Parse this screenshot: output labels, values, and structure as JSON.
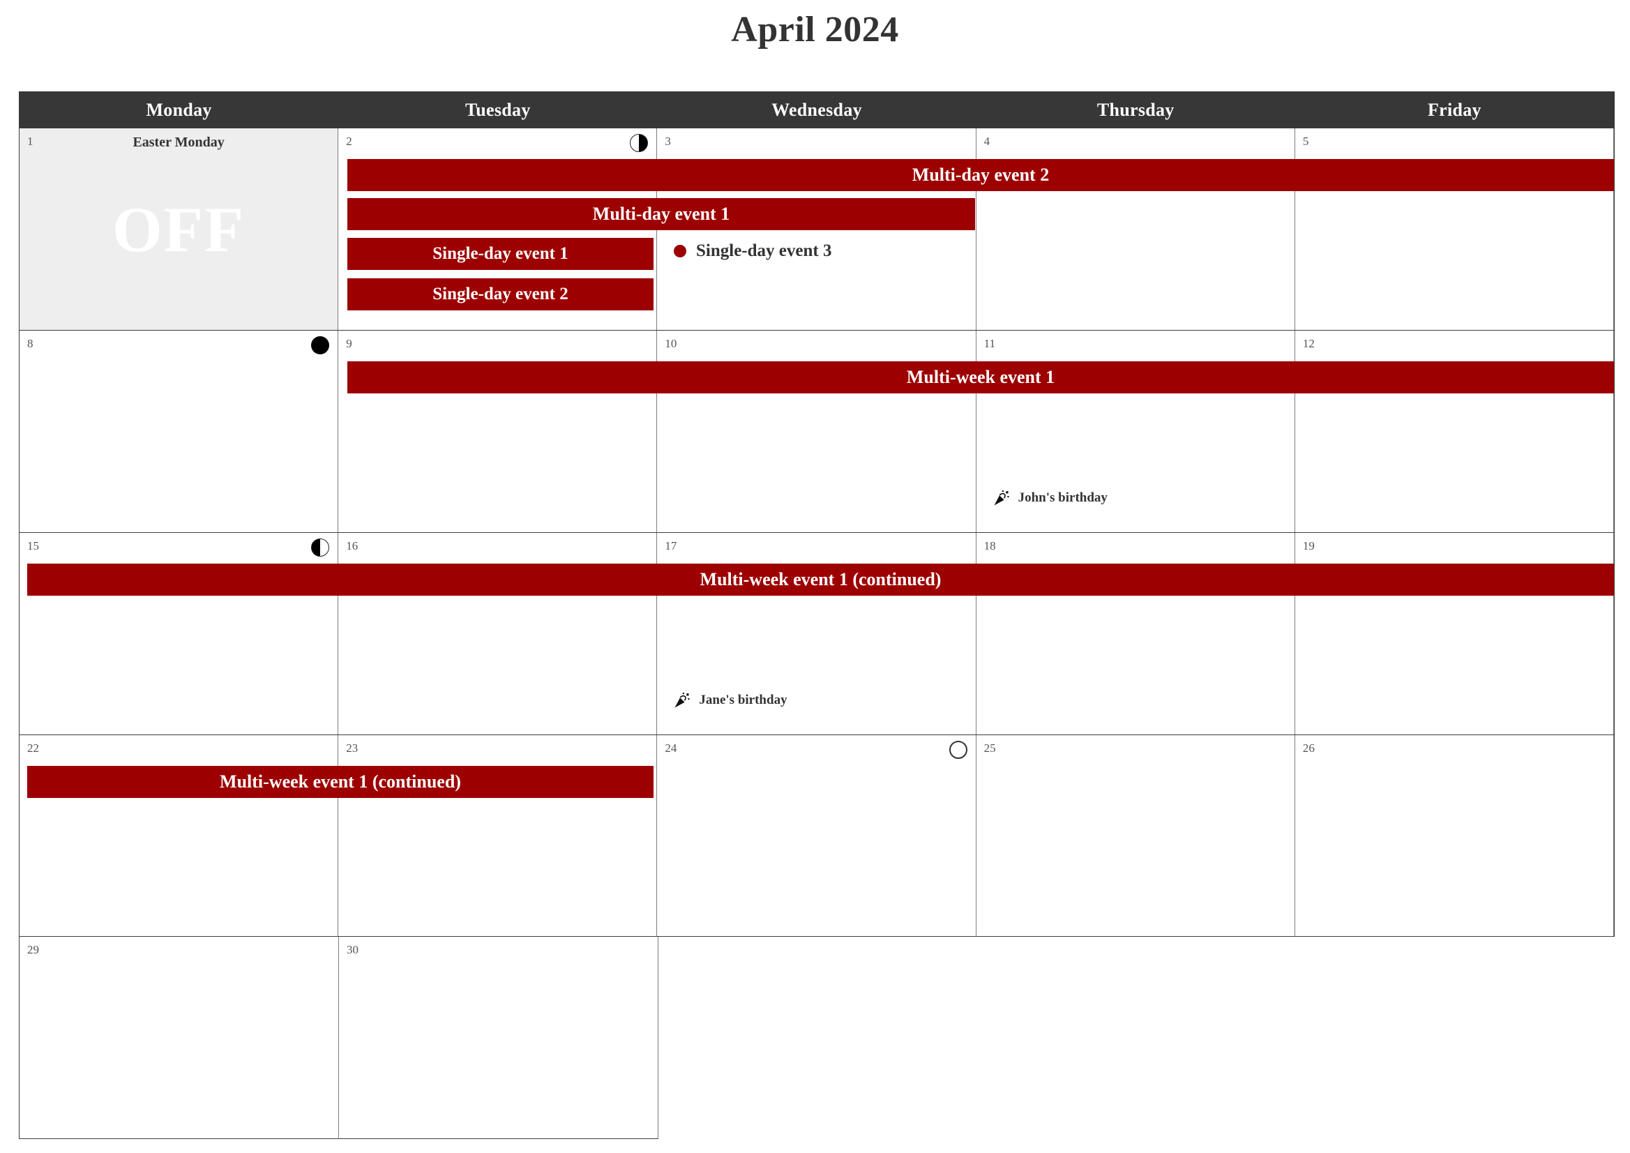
{
  "title": "April 2024",
  "weekdays": [
    {
      "label": "Monday"
    },
    {
      "label": "Tuesday"
    },
    {
      "label": "Wednesday"
    },
    {
      "label": "Thursday"
    },
    {
      "label": "Friday"
    }
  ],
  "colors": {
    "event_red": "#9d0000",
    "header_dark": "#373737",
    "off_day_bg": "#eeeeee",
    "text_dark": "#333333",
    "grid_line": "#7d7d7d"
  },
  "weeks": [
    {
      "days": [
        {
          "number": "1",
          "off": true,
          "holiday": "Easter Monday",
          "off_label": "OFF",
          "moon": ""
        },
        {
          "number": "2",
          "moon": "last-quarter-moon-icon"
        },
        {
          "number": "3",
          "moon": ""
        },
        {
          "number": "4",
          "moon": ""
        },
        {
          "number": "5",
          "moon": ""
        }
      ]
    },
    {
      "days": [
        {
          "number": "8",
          "moon": "new-moon-icon"
        },
        {
          "number": "9",
          "moon": ""
        },
        {
          "number": "10",
          "moon": ""
        },
        {
          "number": "11",
          "moon": ""
        },
        {
          "number": "12",
          "moon": ""
        }
      ]
    },
    {
      "days": [
        {
          "number": "15",
          "moon": "first-quarter-moon-icon"
        },
        {
          "number": "16",
          "moon": ""
        },
        {
          "number": "17",
          "moon": ""
        },
        {
          "number": "18",
          "moon": ""
        },
        {
          "number": "19",
          "moon": ""
        }
      ]
    },
    {
      "days": [
        {
          "number": "22",
          "moon": ""
        },
        {
          "number": "23",
          "moon": ""
        },
        {
          "number": "24",
          "moon": "full-moon-icon"
        },
        {
          "number": "25",
          "moon": ""
        },
        {
          "number": "26",
          "moon": ""
        }
      ]
    },
    {
      "days": [
        {
          "number": "29",
          "moon": ""
        },
        {
          "number": "30",
          "moon": ""
        },
        {
          "number": "",
          "blank": true
        },
        {
          "number": "",
          "blank": true
        },
        {
          "number": "",
          "blank": true
        }
      ]
    }
  ],
  "events": {
    "multi_day_event_2": "Multi-day event 2",
    "multi_day_event_1": "Multi-day event 1",
    "single_day_event_1": "Single-day event 1",
    "single_day_event_2": "Single-day event 2",
    "single_day_event_3": "Single-day event 3",
    "multi_week_event_1": "Multi-week event 1",
    "multi_week_event_1_cont_w3": "Multi-week event 1 (continued)",
    "multi_week_event_1_cont_w4": "Multi-week event 1 (continued)"
  },
  "birthdays": {
    "john": "John's birthday",
    "jane": "Jane's birthday"
  }
}
